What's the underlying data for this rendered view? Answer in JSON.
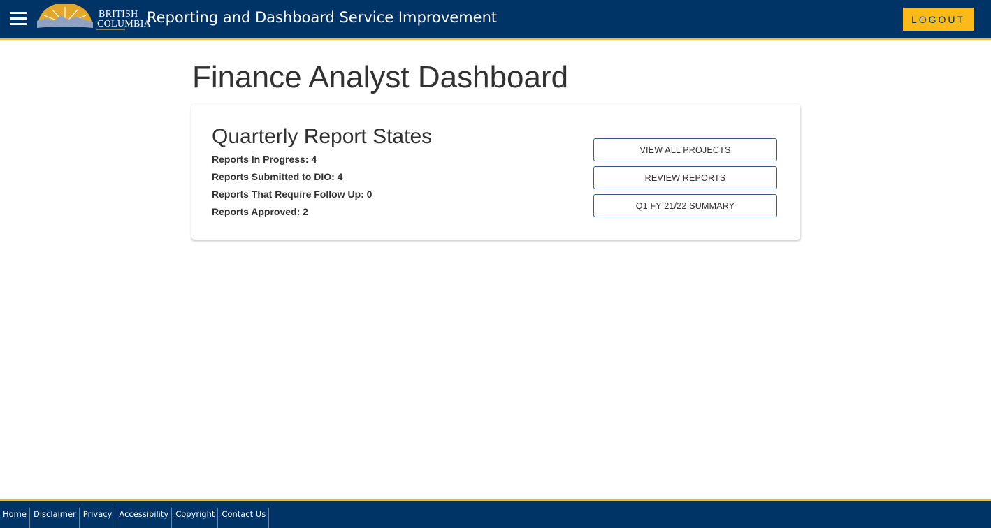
{
  "header": {
    "logo_text_line1": "BRITISH",
    "logo_text_line2": "COLUMBIA",
    "title": "Reporting and Dashboard Service Improvement",
    "logout_label": "LOGOUT"
  },
  "page": {
    "title": "Finance Analyst Dashboard"
  },
  "card": {
    "title": "Quarterly Report States",
    "stats": [
      "Reports In Progress: 4",
      "Reports Submitted to DIO: 4",
      "Reports That Require Follow Up: 0",
      "Reports Approved: 2"
    ],
    "buttons": [
      "VIEW ALL PROJECTS",
      "REVIEW REPORTS",
      "Q1 FY 21/22 SUMMARY"
    ]
  },
  "footer": {
    "links": [
      "Home",
      "Disclaimer",
      "Privacy",
      "Accessibility",
      "Copyright",
      "Contact Us"
    ]
  }
}
